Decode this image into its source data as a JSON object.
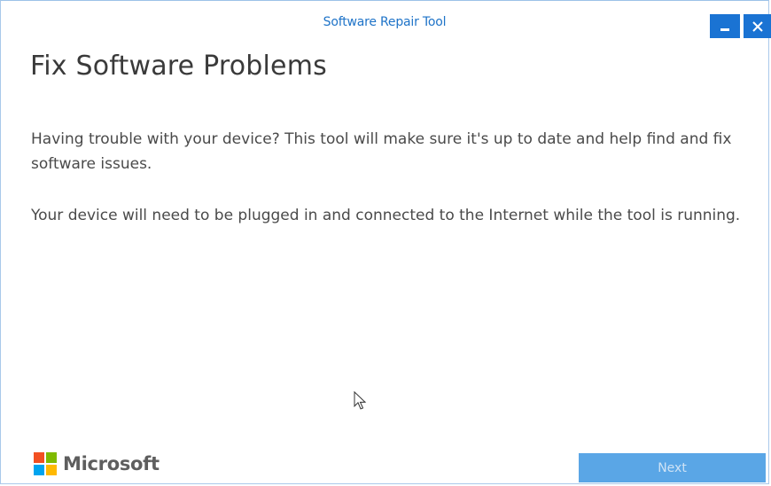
{
  "window": {
    "title": "Software Repair Tool",
    "minimize_icon": "minimize-icon",
    "close_icon": "close-icon"
  },
  "content": {
    "heading": "Fix Software Problems",
    "paragraph_1": "Having trouble with your device? This tool will make sure it's up to date and help find and fix software issues.",
    "paragraph_2": "Your device will need to be plugged in and connected to the Internet while the tool is running."
  },
  "footer": {
    "logo_text": "Microsoft",
    "next_label": "Next",
    "next_enabled": false
  },
  "colors": {
    "accent": "#1a73d3",
    "title_text": "#1e73c8",
    "next_button": "#5aa6e6",
    "logo_red": "#f25022",
    "logo_green": "#7fba00",
    "logo_blue": "#00a4ef",
    "logo_yellow": "#ffb900"
  }
}
